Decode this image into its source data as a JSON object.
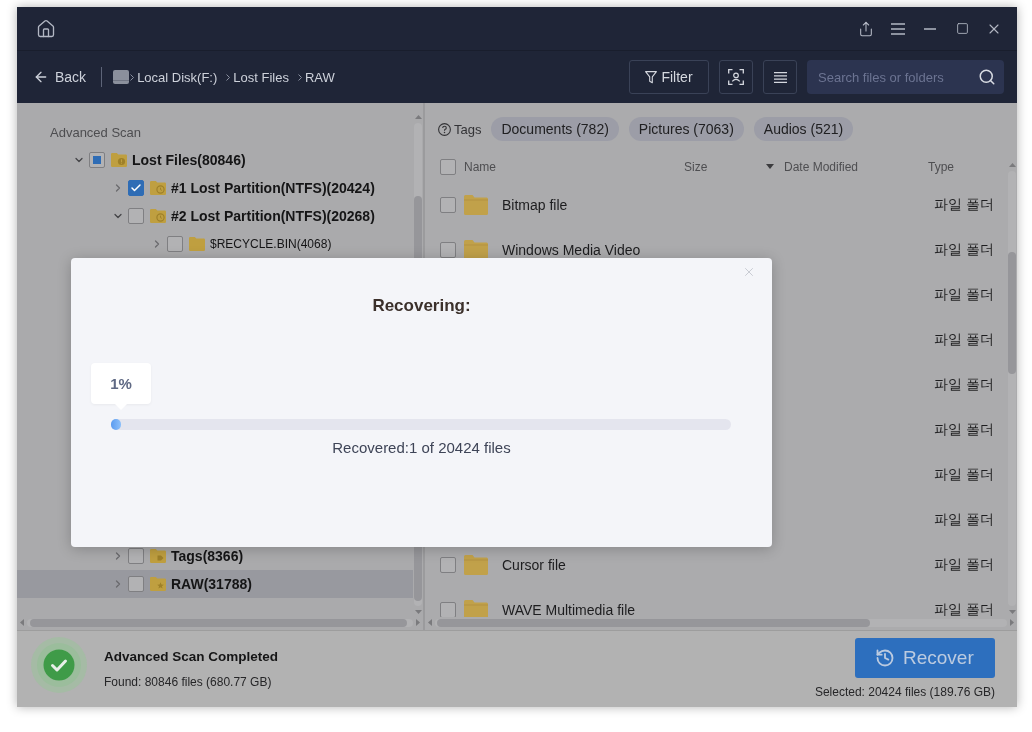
{
  "toolbar": {
    "back_button": "Back",
    "breadcrumb": [
      "Local Disk(F:)",
      "Lost Files",
      "RAW"
    ],
    "filter_button": "Filter",
    "search": {
      "placeholder": "Search files or folders"
    }
  },
  "sidebar": {
    "heading": "Advanced Scan",
    "tree": [
      {
        "label": "Lost Files(80846)",
        "kind": "lost",
        "expanded": true,
        "checked": false,
        "partial": true,
        "selected": false,
        "children": [
          {
            "label": "#1 Lost Partition(NTFS)(20424)",
            "kind": "partition",
            "expanded": false,
            "checked": true,
            "partial": false,
            "selected": false
          },
          {
            "label": "#2 Lost Partition(NTFS)(20268)",
            "kind": "partition",
            "expanded": true,
            "checked": false,
            "partial": false,
            "selected": false,
            "children": [
              {
                "label": "$RECYCLE.BIN(4068)",
                "kind": "folder",
                "expanded": false,
                "checked": false,
                "partial": false,
                "selected": false
              }
            ]
          },
          {
            "label": "Tags(8366)",
            "kind": "tags",
            "expanded": false,
            "checked": false,
            "partial": false,
            "selected": false
          },
          {
            "label": "RAW(31788)",
            "kind": "raw",
            "expanded": false,
            "checked": false,
            "partial": false,
            "selected": true
          }
        ]
      }
    ]
  },
  "tags": {
    "label": "Tags",
    "items": [
      "Documents (782)",
      "Pictures (7063)",
      "Audios (521)"
    ]
  },
  "table": {
    "select_all": {
      "checked": false
    },
    "columns": [
      {
        "label": "Name",
        "sorted": false
      },
      {
        "label": "Size",
        "sorted": true
      },
      {
        "label": "Date Modified",
        "sorted": false
      },
      {
        "label": "Type",
        "sorted": false
      }
    ],
    "rows": [
      {
        "name": "Bitmap file",
        "type": "파일 폴더",
        "checked": false
      },
      {
        "name": "Windows Media Video",
        "type": "파일 폴더",
        "checked": false
      },
      {
        "type": "파일 폴더"
      },
      {
        "type": "파일 폴더"
      },
      {
        "type": "파일 폴더"
      },
      {
        "type": "파일 폴더"
      },
      {
        "type": "파일 폴더"
      },
      {
        "type": "파일 폴더"
      },
      {
        "name": "Cursor file",
        "type": "파일 폴더",
        "checked": false
      },
      {
        "name": "WAVE Multimedia file",
        "type": "파일 폴더",
        "checked": false
      }
    ]
  },
  "status_bar": {
    "title": "Advanced Scan Completed",
    "found": "Found: 80846 files (680.77 GB)",
    "recover_button": "Recover",
    "selected": "Selected: 20424 files (189.76 GB)"
  },
  "dialog": {
    "title": "Recovering:",
    "progress": {
      "level": 0.01,
      "label": "1%"
    },
    "status": "Recovered:1 of 20424 files"
  }
}
